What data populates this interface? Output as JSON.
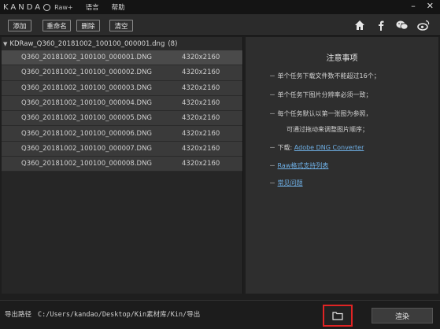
{
  "app": {
    "logo_text": "KANDA",
    "logo_suffix": "Raw+",
    "menu": [
      "语言",
      "帮助"
    ],
    "window_controls": [
      "minimize-icon",
      "close-icon"
    ]
  },
  "toolbar": {
    "add_label": "添加",
    "rename_label": "重命名",
    "delete_label": "删除",
    "clear_label": "清空",
    "social_icons": [
      "home-icon",
      "facebook-icon",
      "wechat-icon",
      "weibo-icon"
    ]
  },
  "file_list": {
    "group_name": "KDRaw_Q360_20181002_100100_000001.dng",
    "group_count": "(8)",
    "files": [
      {
        "name": "Q360_20181002_100100_000001.DNG",
        "resolution": "4320x2160"
      },
      {
        "name": "Q360_20181002_100100_000002.DNG",
        "resolution": "4320x2160"
      },
      {
        "name": "Q360_20181002_100100_000003.DNG",
        "resolution": "4320x2160"
      },
      {
        "name": "Q360_20181002_100100_000004.DNG",
        "resolution": "4320x2160"
      },
      {
        "name": "Q360_20181002_100100_000005.DNG",
        "resolution": "4320x2160"
      },
      {
        "name": "Q360_20181002_100100_000006.DNG",
        "resolution": "4320x2160"
      },
      {
        "name": "Q360_20181002_100100_000007.DNG",
        "resolution": "4320x2160"
      },
      {
        "name": "Q360_20181002_100100_000008.DNG",
        "resolution": "4320x2160"
      }
    ]
  },
  "notes": {
    "title": "注意事项",
    "line1": "－ 单个任务下载文件数不能超过16个；",
    "line2": "－ 单个任务下图片分辨率必须一致；",
    "line3": "－ 每个任务默认以第一张图为参照，",
    "line4": "可通过拖动来调整图片顺序；",
    "download_prefix": "－ 下载: ",
    "download_link": "Adobe DNG Converter",
    "dash": "－ ",
    "raw_support_link": "Raw格式支持列表",
    "faq_link": "常见问题"
  },
  "bottom": {
    "path_label": "导出路径",
    "path_value": "C:/Users/kandao/Desktop/Kin素材库/Kin/导出",
    "render_label": "渲染"
  }
}
